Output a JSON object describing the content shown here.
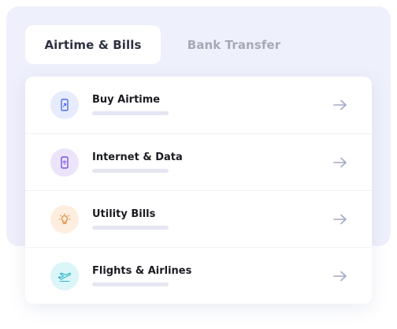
{
  "tabs": {
    "active": "Airtime & Bills",
    "inactive": "Bank Transfer"
  },
  "services": [
    {
      "label": "Buy Airtime",
      "icon": "phone-icon",
      "color": "#4a6cf0",
      "bg": "#e6ecfd"
    },
    {
      "label": "Internet & Data",
      "icon": "wifi-phone-icon",
      "color": "#7a52e3",
      "bg": "#ece4fb"
    },
    {
      "label": "Utility Bills",
      "icon": "lightbulb-icon",
      "color": "#e38a3e",
      "bg": "#fdeedf"
    },
    {
      "label": "Flights & Airlines",
      "icon": "airplane-icon",
      "color": "#2fb6c9",
      "bg": "#dcf5f8"
    }
  ],
  "arrow_icon": "arrow-right-icon"
}
